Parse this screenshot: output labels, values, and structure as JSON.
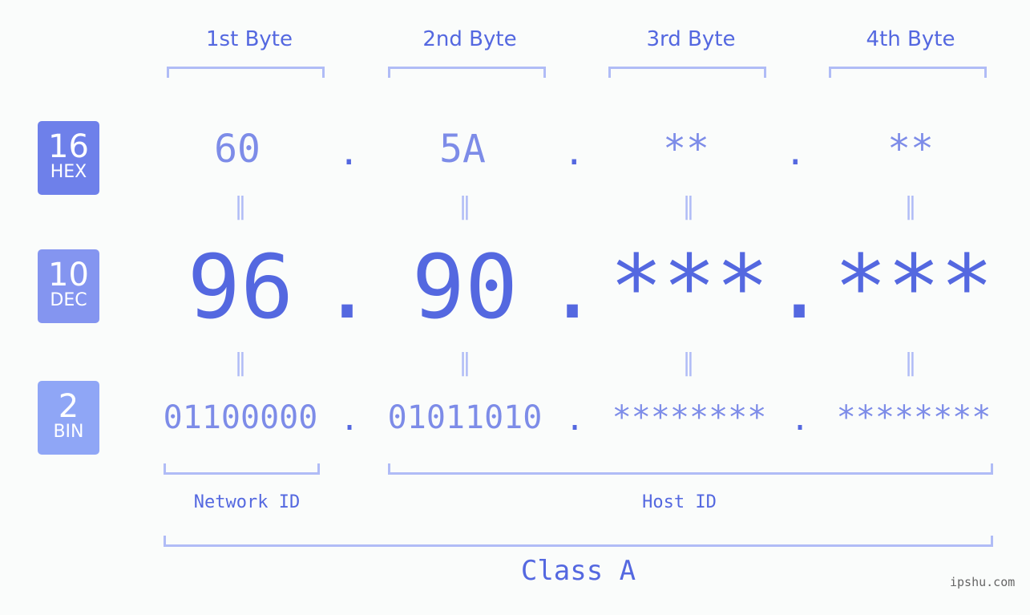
{
  "colors": {
    "hex_badge": "#6e80ea",
    "dec_badge": "#8495f0",
    "bin_badge": "#8fa6f6",
    "accent": "#5468e0",
    "muted": "#7d8ce8",
    "bracket": "#b0bcf6"
  },
  "badges": [
    {
      "num": "16",
      "label": "HEX"
    },
    {
      "num": "10",
      "label": "DEC"
    },
    {
      "num": "2",
      "label": "BIN"
    }
  ],
  "byte_headers": [
    "1st Byte",
    "2nd Byte",
    "3rd Byte",
    "4th Byte"
  ],
  "hex": [
    "60",
    "5A",
    "**",
    "**"
  ],
  "dec": [
    "96",
    "90",
    "***",
    "***"
  ],
  "bin": [
    "01100000",
    "01011010",
    "********",
    "********"
  ],
  "separator": ".",
  "equals": "=",
  "labels": {
    "network": "Network ID",
    "host": "Host ID",
    "class": "Class A"
  },
  "watermark": "ipshu.com"
}
